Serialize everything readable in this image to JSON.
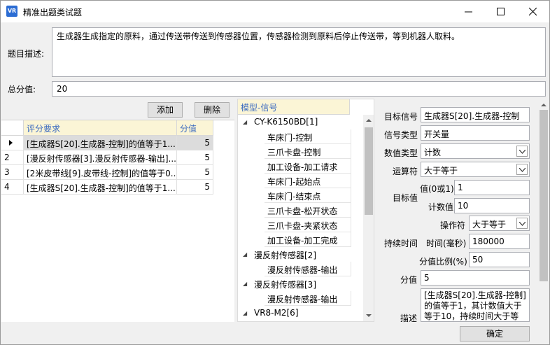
{
  "window": {
    "title": "精准出题类试题",
    "icon_text": "VR"
  },
  "form": {
    "desc_label": "题目描述:",
    "desc_value": "生成器生成指定的原料，通过传送带传送到传感器位置，传感器检测到原料后停止传送带，等到机器人取料。",
    "total_label": "总分值:",
    "total_value": "20"
  },
  "toolbar": {
    "add_label": "添加",
    "delete_label": "删除"
  },
  "grid": {
    "headers": [
      "评分要求",
      "分值"
    ],
    "rows": [
      {
        "num": "1",
        "req": "[生成器S[20].生成器-控制]的值等于1...",
        "score": "5",
        "selected": true
      },
      {
        "num": "2",
        "req": "[漫反射传感器[3].漫反射传感器-输出]...",
        "score": "5",
        "selected": false
      },
      {
        "num": "3",
        "req": "[2米皮带线[9].皮带线-控制]的值等于0...",
        "score": "5",
        "selected": false
      },
      {
        "num": "4",
        "req": "[生成器S[20].生成器-控制]的值等于1...",
        "score": "5",
        "selected": false
      }
    ]
  },
  "tree": {
    "header": "模型-信号",
    "nodes": [
      {
        "label": "CY-K6150BD[1]",
        "children": [
          "车床门-控制",
          "三爪卡盘-控制",
          "加工设备-加工请求",
          "车床门-起始点",
          "车床门-结束点",
          "三爪卡盘-松开状态",
          "三爪卡盘-夹紧状态",
          "加工设备-加工完成"
        ]
      },
      {
        "label": "漫反射传感器[2]",
        "children": [
          "漫反射传感器-输出"
        ]
      },
      {
        "label": "漫反射传感器[3]",
        "children": [
          "漫反射传感器-输出"
        ]
      },
      {
        "label": "VR8-M2[6]",
        "children": []
      }
    ]
  },
  "details": {
    "target_signal_label": "目标信号",
    "target_signal_value": "生成器S[20].生成器-控制",
    "signal_type_label": "信号类型",
    "signal_type_value": "开关量",
    "value_type_label": "数值类型",
    "value_type_value": "计数",
    "operator_label": "运算符",
    "operator_value": "大于等于",
    "target_value_label": "目标值",
    "value01_label": "值(0或1)",
    "value01_value": "1",
    "count_label": "计数值",
    "count_value": "10",
    "op2_label": "操作符",
    "op2_value": "大于等于",
    "duration_label": "持续时间",
    "time_label": "时间(毫秒)",
    "time_value": "180000",
    "ratio_label": "分值比例(%)",
    "ratio_value": "50",
    "score_label": "分值",
    "score_value": "5",
    "desc_label": "描述",
    "desc_value": "[生成器S[20].生成器-控制]的值等于1，其计数值大于等于10，持续时间大于等于",
    "confirm_label": "确定"
  },
  "colors": {
    "header_bg": "#fbf5d6",
    "header_text": "#3d6cc0",
    "selected_row": "#dcdcdc",
    "icon_blue": "#2b6cd3"
  }
}
